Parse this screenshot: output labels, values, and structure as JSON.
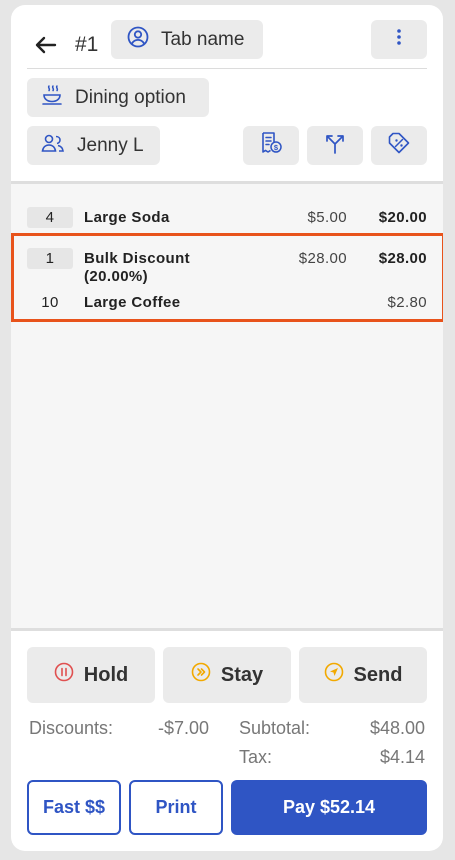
{
  "header": {
    "order_number": "#1",
    "tab_label": "Tab name",
    "dining_label": "Dining option",
    "guest_label": "Jenny L"
  },
  "icons": {
    "back": "arrow-left-icon",
    "tab": "user-circle-icon",
    "menu": "more-vertical-icon",
    "dining": "hot-dish-icon",
    "guest": "guests-icon",
    "receipt": "receipt-dollar-icon",
    "split": "split-arrows-icon",
    "discount": "tag-discount-icon"
  },
  "items": [
    {
      "qty": "4",
      "name": "Large Soda",
      "price": "$5.00",
      "total": "$20.00"
    },
    {
      "qty": "1",
      "name_line1": "Bulk Discount",
      "name_line2": "(20.00%)",
      "price": "$28.00",
      "total": "$28.00"
    },
    {
      "qty": "10",
      "name": "Large Coffee",
      "total": "$2.80"
    }
  ],
  "actions": {
    "hold": "Hold",
    "stay": "Stay",
    "send": "Send"
  },
  "summary": {
    "discounts_label": "Discounts:",
    "discounts_value": "-$7.00",
    "subtotal_label": "Subtotal:",
    "subtotal_value": "$48.00",
    "tax_label": "Tax:",
    "tax_value": "$4.14"
  },
  "footer": {
    "fast_label": "Fast $$",
    "print_label": "Print",
    "pay_label": "Pay $52.14"
  },
  "colors": {
    "accent": "#2f55c4",
    "highlight": "#e8531b",
    "hold_icon": "#e05050",
    "stay_icon": "#f2a900",
    "send_icon": "#f2a900"
  }
}
